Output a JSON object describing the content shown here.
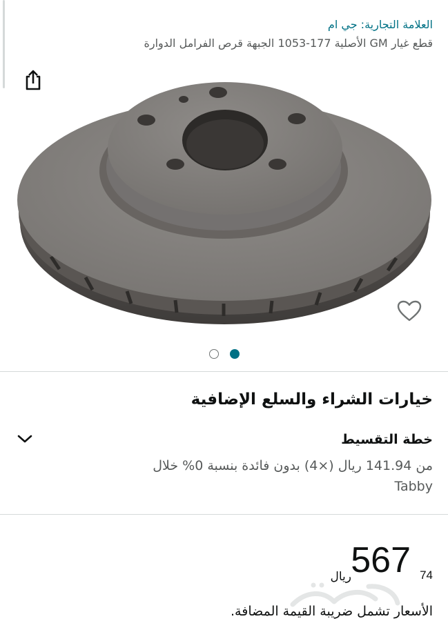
{
  "header": {
    "brand_link": "العلامة التجارية: جي ام",
    "product_title": "قطع غيار GM الأصلية 177-1053 الجبهة قرص الفرامل الدوارة"
  },
  "icons": {
    "share": "share-icon",
    "wishlist": "heart-icon",
    "expand": "chevron-down-icon"
  },
  "carousel": {
    "total": 2,
    "active_index": 2
  },
  "purchase_options": {
    "section_title": "خيارات الشراء والسلع الإضافية",
    "installment": {
      "title": "خطة التقسيط",
      "description": "من 141.94 ريال (×4) بدون فائدة بنسبة 0% خلال",
      "provider": "Tabby"
    }
  },
  "price": {
    "whole": "567",
    "fraction": "74",
    "currency": "ريال"
  },
  "vat_note": "الأسعار تشمل ضريبة القيمة المضافة.",
  "colors": {
    "link": "#007185",
    "secondary_text": "#565959",
    "divider": "#d5d9d9",
    "dot_active": "#007185"
  }
}
